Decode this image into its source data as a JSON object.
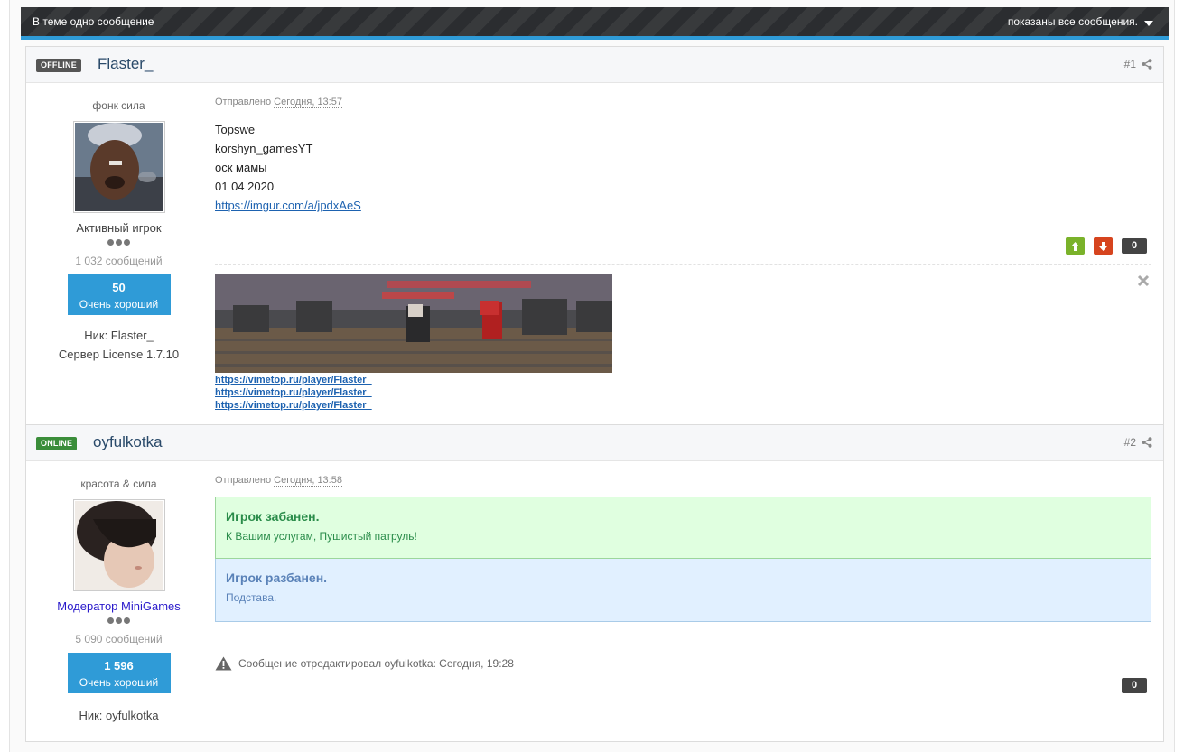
{
  "topic_bar": {
    "left_text": "В теме одно сообщение",
    "right_text": "показаны все сообщения."
  },
  "posts": [
    {
      "status": "OFFLINE",
      "author": "Flaster_",
      "number": "#1",
      "author_title": "фонк сила",
      "rank": "Активный игрок",
      "post_count": "1 032 сообщений",
      "reputation_value": "50",
      "reputation_label": "Очень хороший",
      "profile_fields": [
        "Ник: Flaster_",
        "Сервер License 1.7.10"
      ],
      "posted_label": "Отправлено",
      "posted_date": "Сегодня, 13:57",
      "content_lines": [
        "Topswe",
        "korshyn_gamesYT",
        "оск мамы",
        "01 04 2020"
      ],
      "content_link": "https://imgur.com/a/jpdxAeS",
      "rep_count": "0",
      "signature_links": [
        "https://vimetop.ru/player/Flaster_",
        "https://vimetop.ru/player/Flaster_",
        "https://vimetop.ru/player/Flaster_"
      ]
    },
    {
      "status": "ONLINE",
      "author": "oyfulkotka",
      "number": "#2",
      "author_title": "красота & сила",
      "rank": "Модератор MiniGames",
      "post_count": "5 090 сообщений",
      "reputation_value": "1 596",
      "reputation_label": "Очень хороший",
      "profile_fields": [
        "Ник: oyfulkotka"
      ],
      "posted_label": "Отправлено",
      "posted_date": "Сегодня, 13:58",
      "alert_green_title": "Игрок забанен.",
      "alert_green_text": "К Вашим услугам, Пушистый патруль!",
      "alert_blue_title": "Игрок разбанен.",
      "alert_blue_text": "Подстава.",
      "edit_note": "Сообщение отредактировал oyfulkotka: Сегодня, 19:28",
      "rep_count": "0"
    }
  ],
  "colors": {
    "accent": "#2f9bd7",
    "rep_up": "#7ab22a",
    "rep_down": "#d6441e",
    "online": "#3a8d3a",
    "offline": "#555555"
  },
  "icons": {
    "share": "share-icon",
    "caret": "caret-down-icon",
    "up": "arrow-up-icon",
    "down": "arrow-down-icon",
    "close": "close-icon",
    "warning": "warning-icon"
  }
}
